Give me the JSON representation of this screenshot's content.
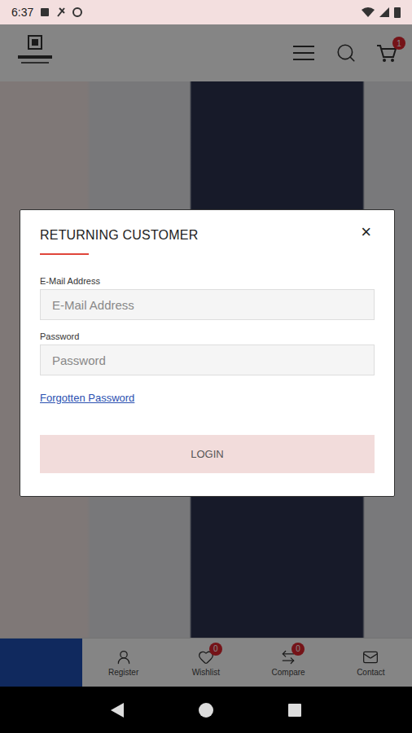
{
  "status_bar": {
    "time": "6:37"
  },
  "header": {
    "cart_count": "1"
  },
  "bottom_nav": [
    {
      "kind": "blank",
      "label": "",
      "badge": "",
      "selected": true
    },
    {
      "kind": "link",
      "label": "Register",
      "badge": "",
      "selected": false
    },
    {
      "kind": "link",
      "label": "Wishlist",
      "badge": "0",
      "selected": false
    },
    {
      "kind": "link",
      "label": "Compare",
      "badge": "0",
      "selected": false
    },
    {
      "kind": "link",
      "label": "Contact",
      "badge": "",
      "selected": false
    }
  ],
  "modal": {
    "title": "RETURNING CUSTOMER",
    "close": "×",
    "fields": [
      {
        "label": "E-Mail Address",
        "placeholder": "E-Mail Address",
        "kind": "email"
      },
      {
        "label": "Password",
        "placeholder": "Password",
        "kind": "password"
      }
    ],
    "link": "Forgotten Password",
    "button": "LOGIN"
  }
}
